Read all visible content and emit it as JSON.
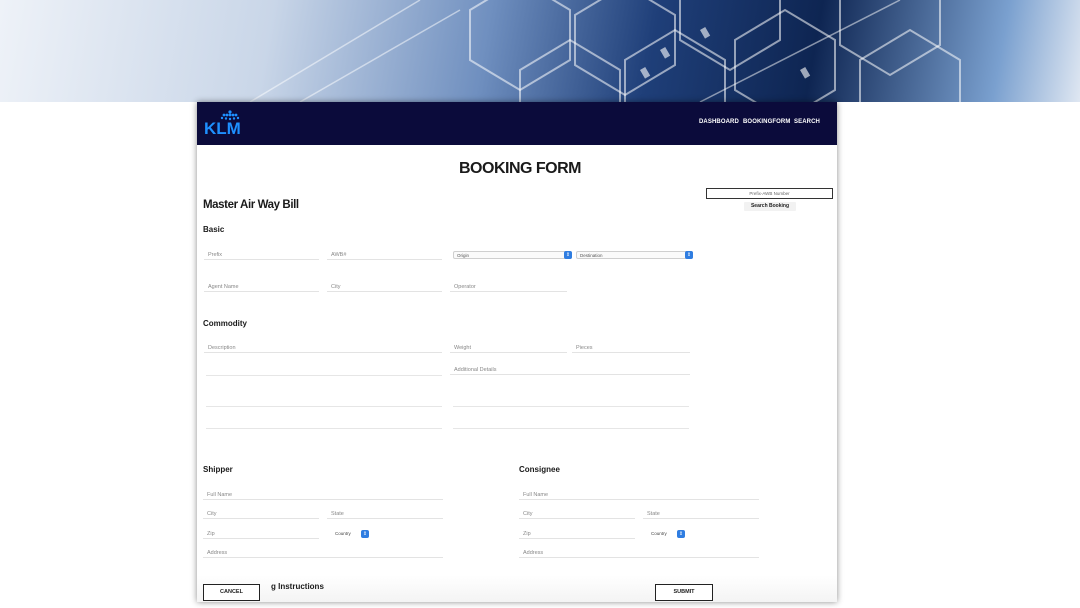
{
  "nav": {
    "brand": "KLM",
    "links": [
      "DASHBOARD",
      "BOOKINGFORM",
      "SEARCH"
    ]
  },
  "page": {
    "title": "BOOKING FORM",
    "awb_search": {
      "placeholder": "Prefix-AWB Number",
      "button": "Search Booking"
    },
    "section_title": "Master Air Way Bill"
  },
  "basic": {
    "heading": "Basic",
    "prefix": "Prefix",
    "awb": "AWB#",
    "origin": "Origin",
    "destination": "Destination",
    "agent_name": "Agent Name",
    "city": "City",
    "operator": "Operator"
  },
  "commodity": {
    "heading": "Commodity",
    "description": "Description",
    "weight": "Weight",
    "pieces": "Pieces",
    "additional": "Additional Details"
  },
  "shipper": {
    "heading": "Shipper",
    "full_name": "Full Name",
    "city": "City",
    "state": "State",
    "zip": "Zip",
    "country": "Country",
    "address": "Address"
  },
  "consignee": {
    "heading": "Consignee",
    "full_name": "Full Name",
    "city": "City",
    "state": "State",
    "zip": "Zip",
    "country": "Country",
    "address": "Address"
  },
  "handling": {
    "heading_visible": "g Instructions"
  },
  "buttons": {
    "cancel": "CANCEL",
    "submit": "SUBMIT"
  },
  "colors": {
    "navbar": "#0b0b3b",
    "logo": "#1e90ff",
    "select_arrow": "#2f7de1"
  }
}
